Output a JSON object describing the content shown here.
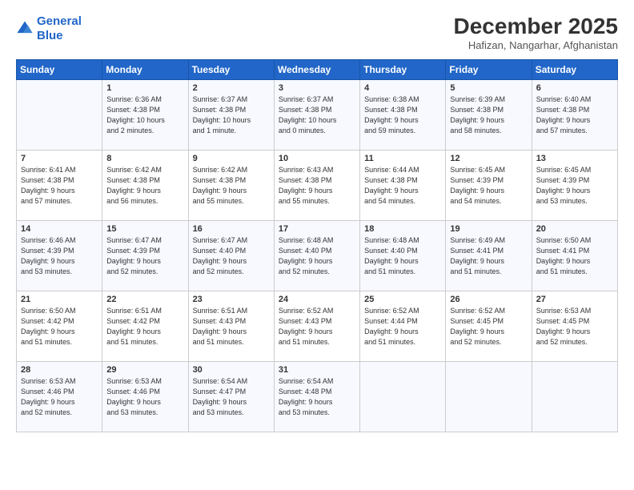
{
  "logo": {
    "line1": "General",
    "line2": "Blue"
  },
  "title": "December 2025",
  "location": "Hafizan, Nangarhar, Afghanistan",
  "days_of_week": [
    "Sunday",
    "Monday",
    "Tuesday",
    "Wednesday",
    "Thursday",
    "Friday",
    "Saturday"
  ],
  "weeks": [
    [
      {
        "num": "",
        "info": ""
      },
      {
        "num": "1",
        "info": "Sunrise: 6:36 AM\nSunset: 4:38 PM\nDaylight: 10 hours\nand 2 minutes."
      },
      {
        "num": "2",
        "info": "Sunrise: 6:37 AM\nSunset: 4:38 PM\nDaylight: 10 hours\nand 1 minute."
      },
      {
        "num": "3",
        "info": "Sunrise: 6:37 AM\nSunset: 4:38 PM\nDaylight: 10 hours\nand 0 minutes."
      },
      {
        "num": "4",
        "info": "Sunrise: 6:38 AM\nSunset: 4:38 PM\nDaylight: 9 hours\nand 59 minutes."
      },
      {
        "num": "5",
        "info": "Sunrise: 6:39 AM\nSunset: 4:38 PM\nDaylight: 9 hours\nand 58 minutes."
      },
      {
        "num": "6",
        "info": "Sunrise: 6:40 AM\nSunset: 4:38 PM\nDaylight: 9 hours\nand 57 minutes."
      }
    ],
    [
      {
        "num": "7",
        "info": "Sunrise: 6:41 AM\nSunset: 4:38 PM\nDaylight: 9 hours\nand 57 minutes."
      },
      {
        "num": "8",
        "info": "Sunrise: 6:42 AM\nSunset: 4:38 PM\nDaylight: 9 hours\nand 56 minutes."
      },
      {
        "num": "9",
        "info": "Sunrise: 6:42 AM\nSunset: 4:38 PM\nDaylight: 9 hours\nand 55 minutes."
      },
      {
        "num": "10",
        "info": "Sunrise: 6:43 AM\nSunset: 4:38 PM\nDaylight: 9 hours\nand 55 minutes."
      },
      {
        "num": "11",
        "info": "Sunrise: 6:44 AM\nSunset: 4:38 PM\nDaylight: 9 hours\nand 54 minutes."
      },
      {
        "num": "12",
        "info": "Sunrise: 6:45 AM\nSunset: 4:39 PM\nDaylight: 9 hours\nand 54 minutes."
      },
      {
        "num": "13",
        "info": "Sunrise: 6:45 AM\nSunset: 4:39 PM\nDaylight: 9 hours\nand 53 minutes."
      }
    ],
    [
      {
        "num": "14",
        "info": "Sunrise: 6:46 AM\nSunset: 4:39 PM\nDaylight: 9 hours\nand 53 minutes."
      },
      {
        "num": "15",
        "info": "Sunrise: 6:47 AM\nSunset: 4:39 PM\nDaylight: 9 hours\nand 52 minutes."
      },
      {
        "num": "16",
        "info": "Sunrise: 6:47 AM\nSunset: 4:40 PM\nDaylight: 9 hours\nand 52 minutes."
      },
      {
        "num": "17",
        "info": "Sunrise: 6:48 AM\nSunset: 4:40 PM\nDaylight: 9 hours\nand 52 minutes."
      },
      {
        "num": "18",
        "info": "Sunrise: 6:48 AM\nSunset: 4:40 PM\nDaylight: 9 hours\nand 51 minutes."
      },
      {
        "num": "19",
        "info": "Sunrise: 6:49 AM\nSunset: 4:41 PM\nDaylight: 9 hours\nand 51 minutes."
      },
      {
        "num": "20",
        "info": "Sunrise: 6:50 AM\nSunset: 4:41 PM\nDaylight: 9 hours\nand 51 minutes."
      }
    ],
    [
      {
        "num": "21",
        "info": "Sunrise: 6:50 AM\nSunset: 4:42 PM\nDaylight: 9 hours\nand 51 minutes."
      },
      {
        "num": "22",
        "info": "Sunrise: 6:51 AM\nSunset: 4:42 PM\nDaylight: 9 hours\nand 51 minutes."
      },
      {
        "num": "23",
        "info": "Sunrise: 6:51 AM\nSunset: 4:43 PM\nDaylight: 9 hours\nand 51 minutes."
      },
      {
        "num": "24",
        "info": "Sunrise: 6:52 AM\nSunset: 4:43 PM\nDaylight: 9 hours\nand 51 minutes."
      },
      {
        "num": "25",
        "info": "Sunrise: 6:52 AM\nSunset: 4:44 PM\nDaylight: 9 hours\nand 51 minutes."
      },
      {
        "num": "26",
        "info": "Sunrise: 6:52 AM\nSunset: 4:45 PM\nDaylight: 9 hours\nand 52 minutes."
      },
      {
        "num": "27",
        "info": "Sunrise: 6:53 AM\nSunset: 4:45 PM\nDaylight: 9 hours\nand 52 minutes."
      }
    ],
    [
      {
        "num": "28",
        "info": "Sunrise: 6:53 AM\nSunset: 4:46 PM\nDaylight: 9 hours\nand 52 minutes."
      },
      {
        "num": "29",
        "info": "Sunrise: 6:53 AM\nSunset: 4:46 PM\nDaylight: 9 hours\nand 53 minutes."
      },
      {
        "num": "30",
        "info": "Sunrise: 6:54 AM\nSunset: 4:47 PM\nDaylight: 9 hours\nand 53 minutes."
      },
      {
        "num": "31",
        "info": "Sunrise: 6:54 AM\nSunset: 4:48 PM\nDaylight: 9 hours\nand 53 minutes."
      },
      {
        "num": "",
        "info": ""
      },
      {
        "num": "",
        "info": ""
      },
      {
        "num": "",
        "info": ""
      }
    ]
  ]
}
